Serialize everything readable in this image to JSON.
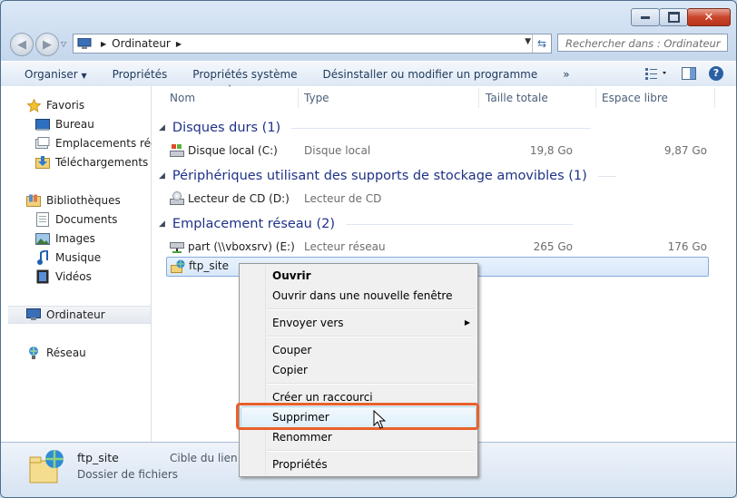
{
  "window": {
    "caption_buttons": {
      "minimize": "minimize",
      "maximize": "maximize",
      "close": "✕"
    }
  },
  "nav": {
    "address_segment": "Ordinateur",
    "search_placeholder": "Rechercher dans : Ordinateur"
  },
  "toolbar": {
    "organize": "Organiser",
    "properties": "Propriétés",
    "system_properties": "Propriétés système",
    "uninstall": "Désinstaller ou modifier un programme",
    "more": "»"
  },
  "sidebar": {
    "favorites": "Favoris",
    "desktop": "Bureau",
    "recent": "Emplacements récen",
    "downloads": "Téléchargements",
    "libraries": "Bibliothèques",
    "documents": "Documents",
    "images": "Images",
    "music": "Musique",
    "videos": "Vidéos",
    "computer": "Ordinateur",
    "network": "Réseau"
  },
  "columns": {
    "name": "Nom",
    "type": "Type",
    "total": "Taille totale",
    "free": "Espace libre"
  },
  "groups": {
    "hard_disks": "Disques durs (1)",
    "removable": "Périphériques utilisant des supports de stockage amovibles (1)",
    "network": "Emplacement réseau (2)"
  },
  "items": {
    "local_disk": {
      "name": "Disque local (C:)",
      "type": "Disque local",
      "total": "19,8 Go",
      "free": "9,87 Go"
    },
    "cd_drive": {
      "name": "Lecteur de CD (D:)",
      "type": "Lecteur de CD"
    },
    "part": {
      "name": "part (\\\\vboxsrv) (E:)",
      "type": "Lecteur réseau",
      "total": "265 Go",
      "free": "176 Go"
    },
    "ftp": {
      "name": "ftp_site"
    }
  },
  "context_menu": {
    "open": "Ouvrir",
    "open_new_window": "Ouvrir dans une nouvelle fenêtre",
    "send_to": "Envoyer vers",
    "cut": "Couper",
    "copy": "Copier",
    "create_shortcut": "Créer un raccourci",
    "delete": "Supprimer",
    "rename": "Renommer",
    "properties": "Propriétés"
  },
  "status": {
    "name": "ftp_site",
    "type": "Dossier de fichiers",
    "target_label": "Cible du lien :"
  },
  "colors": {
    "highlight_box": "#e8612c",
    "group_header": "#1e3287"
  }
}
